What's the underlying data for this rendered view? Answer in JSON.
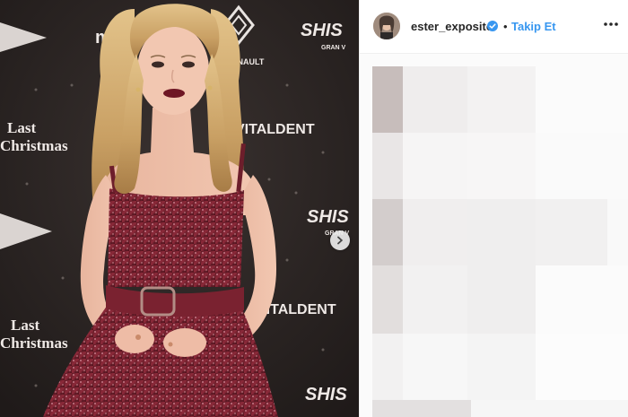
{
  "post": {
    "username": "ester_exposito",
    "separator": "•",
    "follow_label": "Takip Et",
    "verified_icon": "verified-badge-icon",
    "more_icon": "more-options-icon",
    "next_icon": "chevron-right-icon",
    "accent_color": "#3897f0"
  },
  "photo": {
    "backdrop_text": {
      "film_title_line1": "Last",
      "film_title_line2": "Christmas",
      "sponsor_1": "SHIS",
      "sponsor_1_sub": "GRAN V",
      "sponsor_2": "VITALDENT",
      "sponsor_3": "RENAULT",
      "sponsor_4": "mo"
    }
  },
  "comments": {
    "state": "pixelated"
  }
}
